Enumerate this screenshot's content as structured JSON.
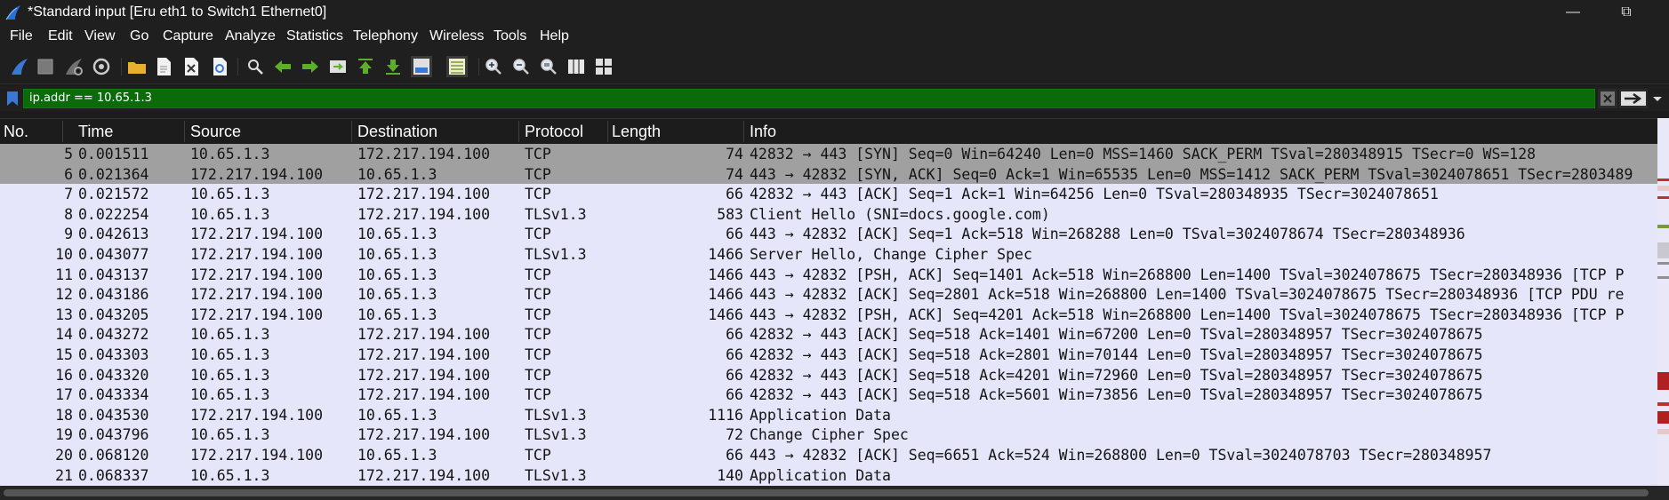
{
  "window": {
    "title": "*Standard input [Eru eth1 to Switch1 Ethernet0]"
  },
  "menu": [
    "File",
    "Edit",
    "View",
    "Go",
    "Capture",
    "Analyze",
    "Statistics",
    "Telephony",
    "Wireless",
    "Tools",
    "Help"
  ],
  "filter": {
    "value": "ip.addr == 10.65.1.3"
  },
  "columns": {
    "no": "No.",
    "time": "Time",
    "source": "Source",
    "destination": "Destination",
    "protocol": "Protocol",
    "length": "Length",
    "info": "Info"
  },
  "packets": [
    {
      "no": "5",
      "time": "0.001511",
      "src": "10.65.1.3",
      "dst": "172.217.194.100",
      "proto": "TCP",
      "len": "74",
      "info": "42832 → 443 [SYN] Seq=0 Win=64240 Len=0 MSS=1460 SACK_PERM TSval=280348915 TSecr=0 WS=128"
    },
    {
      "no": "6",
      "time": "0.021364",
      "src": "172.217.194.100",
      "dst": "10.65.1.3",
      "proto": "TCP",
      "len": "74",
      "info": "443 → 42832 [SYN, ACK] Seq=0 Ack=1 Win=65535 Len=0 MSS=1412 SACK_PERM TSval=3024078651 TSecr=2803489"
    },
    {
      "no": "7",
      "time": "0.021572",
      "src": "10.65.1.3",
      "dst": "172.217.194.100",
      "proto": "TCP",
      "len": "66",
      "info": "42832 → 443 [ACK] Seq=1 Ack=1 Win=64256 Len=0 TSval=280348935 TSecr=3024078651"
    },
    {
      "no": "8",
      "time": "0.022254",
      "src": "10.65.1.3",
      "dst": "172.217.194.100",
      "proto": "TLSv1.3",
      "len": "583",
      "info": "Client Hello (SNI=docs.google.com)"
    },
    {
      "no": "9",
      "time": "0.042613",
      "src": "172.217.194.100",
      "dst": "10.65.1.3",
      "proto": "TCP",
      "len": "66",
      "info": "443 → 42832 [ACK] Seq=1 Ack=518 Win=268288 Len=0 TSval=3024078674 TSecr=280348936"
    },
    {
      "no": "10",
      "time": "0.043077",
      "src": "172.217.194.100",
      "dst": "10.65.1.3",
      "proto": "TLSv1.3",
      "len": "1466",
      "info": "Server Hello, Change Cipher Spec"
    },
    {
      "no": "11",
      "time": "0.043137",
      "src": "172.217.194.100",
      "dst": "10.65.1.3",
      "proto": "TCP",
      "len": "1466",
      "info": "443 → 42832 [PSH, ACK] Seq=1401 Ack=518 Win=268800 Len=1400 TSval=3024078675 TSecr=280348936 [TCP P"
    },
    {
      "no": "12",
      "time": "0.043186",
      "src": "172.217.194.100",
      "dst": "10.65.1.3",
      "proto": "TCP",
      "len": "1466",
      "info": "443 → 42832 [ACK] Seq=2801 Ack=518 Win=268800 Len=1400 TSval=3024078675 TSecr=280348936 [TCP PDU re"
    },
    {
      "no": "13",
      "time": "0.043205",
      "src": "172.217.194.100",
      "dst": "10.65.1.3",
      "proto": "TCP",
      "len": "1466",
      "info": "443 → 42832 [PSH, ACK] Seq=4201 Ack=518 Win=268800 Len=1400 TSval=3024078675 TSecr=280348936 [TCP P"
    },
    {
      "no": "14",
      "time": "0.043272",
      "src": "10.65.1.3",
      "dst": "172.217.194.100",
      "proto": "TCP",
      "len": "66",
      "info": "42832 → 443 [ACK] Seq=518 Ack=1401 Win=67200 Len=0 TSval=280348957 TSecr=3024078675"
    },
    {
      "no": "15",
      "time": "0.043303",
      "src": "10.65.1.3",
      "dst": "172.217.194.100",
      "proto": "TCP",
      "len": "66",
      "info": "42832 → 443 [ACK] Seq=518 Ack=2801 Win=70144 Len=0 TSval=280348957 TSecr=3024078675"
    },
    {
      "no": "16",
      "time": "0.043320",
      "src": "10.65.1.3",
      "dst": "172.217.194.100",
      "proto": "TCP",
      "len": "66",
      "info": "42832 → 443 [ACK] Seq=518 Ack=4201 Win=72960 Len=0 TSval=280348957 TSecr=3024078675"
    },
    {
      "no": "17",
      "time": "0.043334",
      "src": "10.65.1.3",
      "dst": "172.217.194.100",
      "proto": "TCP",
      "len": "66",
      "info": "42832 → 443 [ACK] Seq=518 Ack=5601 Win=73856 Len=0 TSval=280348957 TSecr=3024078675"
    },
    {
      "no": "18",
      "time": "0.043530",
      "src": "172.217.194.100",
      "dst": "10.65.1.3",
      "proto": "TLSv1.3",
      "len": "1116",
      "info": "Application Data"
    },
    {
      "no": "19",
      "time": "0.043796",
      "src": "10.65.1.3",
      "dst": "172.217.194.100",
      "proto": "TLSv1.3",
      "len": "72",
      "info": "Change Cipher Spec"
    },
    {
      "no": "20",
      "time": "0.068120",
      "src": "172.217.194.100",
      "dst": "10.65.1.3",
      "proto": "TCP",
      "len": "66",
      "info": "443 → 42832 [ACK] Seq=6651 Ack=524 Win=268800 Len=0 TSval=3024078703 TSecr=280348957"
    },
    {
      "no": "21",
      "time": "0.068337",
      "src": "10.65.1.3",
      "dst": "172.217.194.100",
      "proto": "TLSv1.3",
      "len": "140",
      "info": "Application Data"
    }
  ],
  "selected_rows": [
    "5",
    "6"
  ],
  "colors": {
    "row_background": "#e6e6fa",
    "selected_row": "#a0a0a0",
    "filter_valid": "#0b6b0b",
    "toolbar_accent": "#3a78d6"
  },
  "toolbar": {
    "icons": [
      "shark-fin-start-icon",
      "stop-capture-icon",
      "restart-capture-icon",
      "capture-options-icon",
      "open-file-icon",
      "save-file-icon",
      "close-file-icon",
      "reload-file-icon",
      "find-packet-icon",
      "go-back-icon",
      "go-forward-icon",
      "go-to-packet-icon",
      "go-first-icon",
      "go-last-icon",
      "auto-scroll-icon",
      "colorize-icon",
      "zoom-in-icon",
      "zoom-out-icon",
      "zoom-normal-icon",
      "resize-columns-icon",
      "layout-icon"
    ]
  }
}
